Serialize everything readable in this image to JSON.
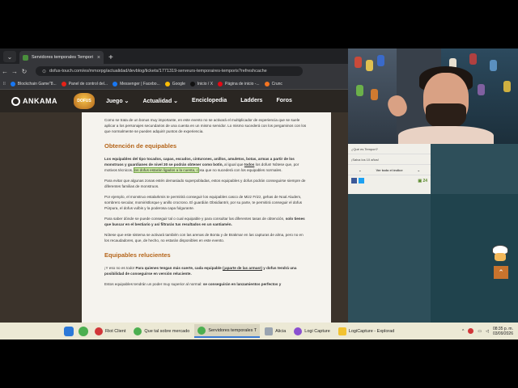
{
  "browser": {
    "tab_title": "Servidores temporales Tempori",
    "tab_close": "×",
    "new_tab": "+",
    "url": "dofus-touch.com/es/mmorpg/actualidad/devblog/tickets/1771319-serveurs-temporaires-temporis?refreshcache",
    "bookmarks": [
      "Blockchain Game\"8...",
      "Panel de control del...",
      "Messenger | Facebo...",
      "Google",
      "Inicio / X",
      "Página de inicio -...",
      "Crunc"
    ]
  },
  "site": {
    "brand": "ANKAMA",
    "game_logo": "DOFUS",
    "menu": [
      "Juego ⌄",
      "Actualidad ⌄",
      "Enciclopedia",
      "Ladders",
      "Foros"
    ]
  },
  "article": {
    "intro": "Como se trata de un bonus muy importante, en este evento no se activará el multiplicador de experiencia que se suele aplicar a los personajes secundarios de una cuenta en un mismo servidor. Lo mismo sucederá con los pergaminos con los que normalmente se pueden adquirir puntos de experiencia.",
    "h_obtencion": "Obtención de equipables",
    "p1_bold": "Los equipables del tipo tocados, capas, escudos, cinturones, anillos, amuletos, botas, armas a partir de los monstruos y guardianes de nivel 30 se podrán obtener como botín,",
    "p1_a": " al igual que ",
    "p1_todos": "todos",
    "p1_b": " los dofus! Nótese que, por motivos técnicos, ",
    "p1_hl": "los dofus estarán ligados a la cuenta, c",
    "p1_c": "osa que no sucederá con los equipables normales.",
    "p2": "Para evitar que algunas zonas estén demasiado superpobladas, estos equipables y dofus podrán conseguirse siempre de diferentes familias de monstruos.",
    "p3": "Por ejemplo, el monstruo estalarkmis te permitirá conseguir los equipables casco de Mizz Frizz, gehas de Noal Aludem, sombrero secular, momiristlorque y anillo crocrono. El guardián Obsidiantrir, por su parte, te permitirá conseguir el dofus Púrpura, el dofus vulbis y la poderosa capa fulgurante.",
    "p4_a": "Para saber dónde se puede conseguir tal o cual equipable y para consultar las diferentes tasas de obtención, ",
    "p4_b": "solo tienes que buscar en el bestiario y así filtrarás tus resultados en un santiamén.",
    "p5": "Nótese que este sistema se activará también con las arenas de Bonta y de Brakmar en las capturas de alma, pero no en los recaudadores, que, de hecho, no estarán disponibles en este evento.",
    "h_relucientes": "Equipables relucientes",
    "p6_a": "¡Y eso no es todo! ",
    "p6_b": "Para quienes tengan más suerte, cada equipable ",
    "p6_c": "(¡aparte de las armas!)",
    "p6_d": " y dofus tendrá una posibilidad de conseguirse en versión reluciente.",
    "p7_a": "Estos equipables tendrán un poder muy superior al normal: ",
    "p7_b": "se conseguirán en lanzamientos perfectos y"
  },
  "sidebar": {
    "q1": "¿Qué es Tempori?",
    "q2": "¡Salva los 10 años!",
    "index_label": "Ver todo el índice",
    "comment_count": "24"
  },
  "taskbar": {
    "items": [
      "Riot Client",
      "Que tal sobre mercado",
      "Servidores temporales T",
      "Alicia",
      "Logi Capture",
      "LogiCapture - Explorad"
    ],
    "time": "08:35 p. m.",
    "date": "03/09/2026"
  }
}
